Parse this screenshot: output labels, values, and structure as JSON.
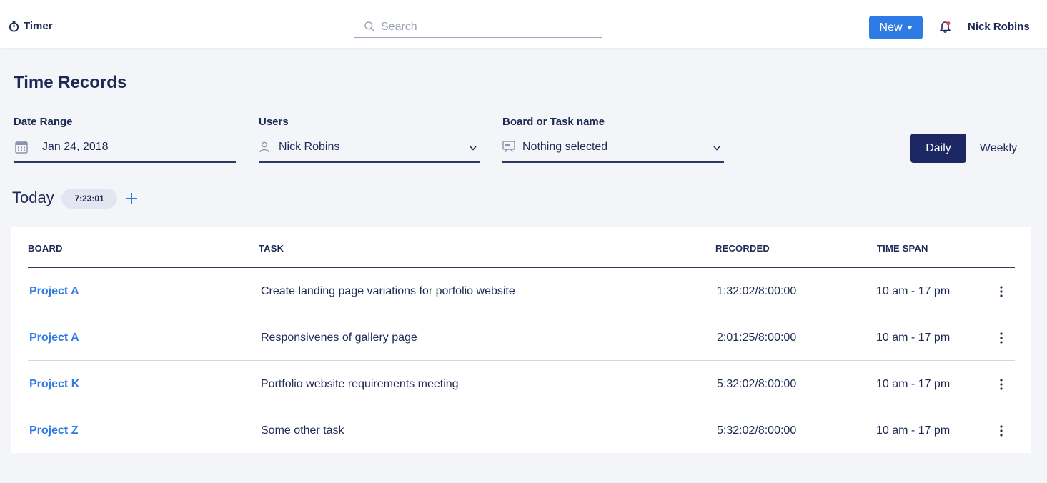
{
  "header": {
    "app_name": "Timer",
    "search_placeholder": "Search",
    "new_label": "New",
    "user_name": "Nick Robins"
  },
  "page": {
    "title": "Time Records"
  },
  "filters": {
    "date_range": {
      "label": "Date Range",
      "value": "Jan 24, 2018"
    },
    "users": {
      "label": "Users",
      "value": "Nick Robins"
    },
    "board": {
      "label": "Board or Task name",
      "value": "Nothing selected"
    }
  },
  "view_toggle": {
    "daily": "Daily",
    "weekly": "Weekly",
    "selected": "Daily"
  },
  "today": {
    "label": "Today",
    "total": "7:23:01"
  },
  "table": {
    "columns": [
      "BOARD",
      "TASK",
      "RECORDED",
      "TIME SPAN"
    ],
    "rows": [
      {
        "board": "Project A",
        "task": "Create landing page variations for porfolio website",
        "recorded": "1:32:02/8:00:00",
        "time_span": "10 am - 17 pm"
      },
      {
        "board": "Project A",
        "task": "Responsivenes of gallery page",
        "recorded": "2:01:25/8:00:00",
        "time_span": "10 am - 17 pm"
      },
      {
        "board": "Project K",
        "task": "Portfolio website requirements meeting",
        "recorded": "5:32:02/8:00:00",
        "time_span": "10 am - 17 pm"
      },
      {
        "board": "Project Z",
        "task": "Some other task",
        "recorded": "5:32:02/8:00:00",
        "time_span": "10 am - 17 pm"
      }
    ]
  },
  "colors": {
    "accent": "#2f7be5",
    "navy": "#1b2864",
    "text": "#1d2a55",
    "background": "#f4f5f9"
  },
  "icons": [
    "stopwatch-icon",
    "search-icon",
    "caret-down-icon",
    "bell-icon",
    "calendar-icon",
    "user-icon",
    "board-icon",
    "chevron-down-icon",
    "plus-icon",
    "more-vertical-icon"
  ]
}
